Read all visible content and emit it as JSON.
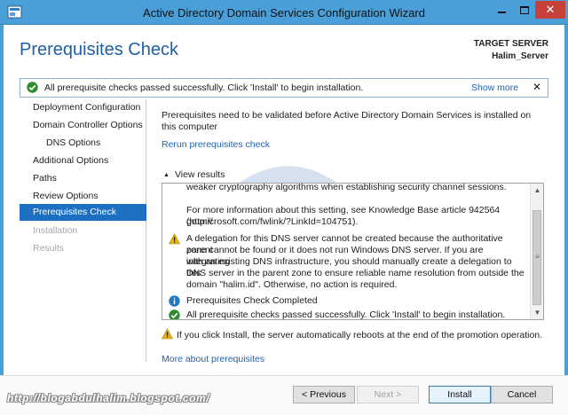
{
  "window": {
    "title": "Active Directory Domain Services Configuration Wizard",
    "min_glyph": "",
    "close_glyph": "✕"
  },
  "header": {
    "page_title": "Prerequisites Check",
    "target_label": "TARGET SERVER",
    "target_value": "Halim_Server"
  },
  "notification": {
    "text": "All prerequisite checks passed successfully.  Click 'Install' to begin installation.",
    "show_more": "Show more",
    "close_glyph": "✕"
  },
  "nav": {
    "items": [
      {
        "label": "Deployment Configuration",
        "state": "normal"
      },
      {
        "label": "Domain Controller Options",
        "state": "normal"
      },
      {
        "label": "DNS Options",
        "state": "sub"
      },
      {
        "label": "Additional Options",
        "state": "normal"
      },
      {
        "label": "Paths",
        "state": "normal"
      },
      {
        "label": "Review Options",
        "state": "normal"
      },
      {
        "label": "Prerequisites Check",
        "state": "active"
      },
      {
        "label": "Installation",
        "state": "disabled"
      },
      {
        "label": "Results",
        "state": "disabled"
      }
    ]
  },
  "content": {
    "intro": "Prerequisites need to be validated before Active Directory Domain Services is installed on this computer",
    "rerun_link": "Rerun prerequisites check",
    "view_results_caret": "▲",
    "view_results": "View results",
    "results": {
      "line_top": "weaker cryptography algorithms when establishing security channel sessions.",
      "line_kb_1": "For more information about this setting, see Knowledge Base article 942564 (http://",
      "line_kb_2": "go.microsoft.com/fwlink/?LinkId=104751).",
      "warn_1": "A delegation for this DNS server cannot be created because the authoritative parent",
      "warn_2": "zone cannot be found or it does not run Windows DNS server. If you are integrating",
      "warn_3": "with an existing DNS infrastructure, you should manually create a delegation to this",
      "warn_4": "DNS server in the parent zone to ensure reliable name resolution from outside the",
      "warn_5": "domain \"halim.id\". Otherwise, no action is required.",
      "info_completed": "Prerequisites Check Completed",
      "success": "All prerequisite checks passed successfully.  Click 'Install' to begin installation."
    },
    "reboot_warning": "If you click Install, the server automatically reboots at the end of the promotion operation.",
    "more_link": "More about prerequisites"
  },
  "scrollbar": {
    "up_glyph": "▲",
    "down_glyph": "▼",
    "grip_glyph": "≡"
  },
  "footer": {
    "blog_url": "http://blogabdulhalim.blogspot.com/",
    "previous": "< Previous",
    "next": "Next >",
    "install": "Install",
    "cancel": "Cancel"
  },
  "colors": {
    "titlebar": "#4a9fd8",
    "accent": "#1f5fa6",
    "nav_active": "#1c6fc1",
    "link": "#1f62b0",
    "success": "#2e8b2e",
    "warning": "#e8b30f",
    "info": "#1f7ac4",
    "close": "#c7413a"
  },
  "icons": {
    "app": "server-manager-icon",
    "success": "check-circle-icon",
    "warning": "warning-triangle-icon",
    "info": "info-circle-icon"
  }
}
